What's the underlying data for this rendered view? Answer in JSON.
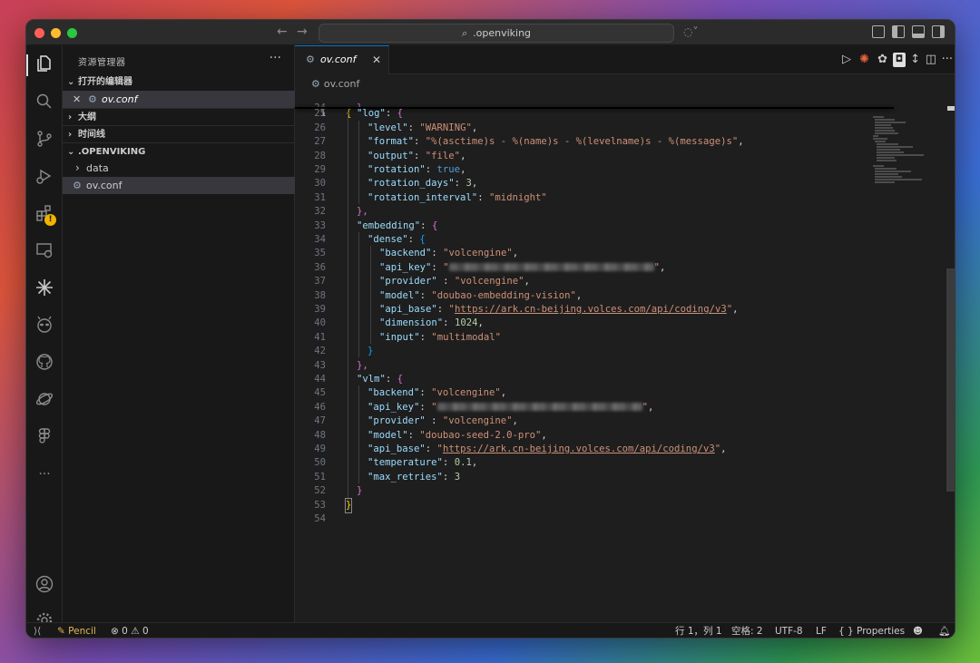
{
  "titlebar": {
    "search_text": ".openviking",
    "back_arrow": "←",
    "forward_arrow": "→"
  },
  "activity_icons": [
    "explorer-icon",
    "search-icon",
    "source-control-icon",
    "run-debug-icon",
    "extensions-icon",
    "remote-explorer-icon",
    "sparkle-icon",
    "alien-icon",
    "github-icon",
    "planet-icon",
    "figma-icon",
    "more-icon",
    "account-icon",
    "settings-icon"
  ],
  "sidebar": {
    "title": "资源管理器",
    "more": "···",
    "open_editors": "打开的编辑器",
    "open_editor_file": "ov.conf",
    "outline": "大纲",
    "timeline": "时间线",
    "workspace": ".OPENVIKING",
    "tree": [
      {
        "label": "data"
      },
      {
        "label": "ov.conf"
      }
    ]
  },
  "tab": {
    "label": "ov.conf",
    "close": "✕"
  },
  "breadcrumb": {
    "file": "ov.conf"
  },
  "editor": {
    "sticky_line": {
      "number": "1",
      "text": "{"
    },
    "lines": [
      {
        "n": "25"
      },
      {
        "n": "26"
      },
      {
        "n": "27"
      },
      {
        "n": "28"
      },
      {
        "n": "29"
      },
      {
        "n": "30"
      },
      {
        "n": "31"
      },
      {
        "n": "32"
      },
      {
        "n": "33"
      },
      {
        "n": "34"
      },
      {
        "n": "35"
      },
      {
        "n": "36"
      },
      {
        "n": "37"
      },
      {
        "n": "38"
      },
      {
        "n": "39"
      },
      {
        "n": "40"
      },
      {
        "n": "41"
      },
      {
        "n": "42"
      },
      {
        "n": "43"
      },
      {
        "n": "44"
      },
      {
        "n": "45"
      },
      {
        "n": "46"
      },
      {
        "n": "47"
      },
      {
        "n": "48"
      },
      {
        "n": "49"
      },
      {
        "n": "50"
      },
      {
        "n": "51"
      },
      {
        "n": "52"
      },
      {
        "n": "53"
      },
      {
        "n": "54"
      }
    ],
    "code": {
      "log_key": "\"log\"",
      "level_key": "\"level\"",
      "level_val": "\"WARNING\"",
      "format_key": "\"format\"",
      "format_val": "\"%(asctime)s - %(name)s - %(levelname)s - %(message)s\"",
      "output_key": "\"output\"",
      "output_val": "\"file\"",
      "rotation_key": "\"rotation\"",
      "rotation_val": "true",
      "rotation_days_key": "\"rotation_days\"",
      "rotation_days_val": "3",
      "rotation_interval_key": "\"rotation_interval\"",
      "rotation_interval_val": "\"midnight\"",
      "embedding_key": "\"embedding\"",
      "dense_key": "\"dense\"",
      "backend_key": "\"backend\"",
      "backend_val": "\"volcengine\"",
      "api_key_key": "\"api_key\"",
      "provider_key": "\"provider\"",
      "provider_val": "\"volcengine\"",
      "model_key": "\"model\"",
      "emb_model_val": "\"doubao-embedding-vision\"",
      "api_base_key": "\"api_base\"",
      "api_base_url": "https://ark.cn-beijing.volces.com/api/coding/v3",
      "dimension_key": "\"dimension\"",
      "dimension_val": "1024",
      "input_key": "\"input\"",
      "input_val": "\"multimodal\"",
      "vlm_key": "\"vlm\"",
      "vlm_model_val": "\"doubao-seed-2.0-pro\"",
      "temperature_key": "\"temperature\"",
      "temperature_val": "0.1",
      "max_retries_key": "\"max_retries\"",
      "max_retries_val": "3"
    }
  },
  "statusbar": {
    "pencil": "Pencil",
    "errors": "0",
    "warnings": "0",
    "position": "行 1，列 1",
    "spaces": "空格: 2",
    "encoding": "UTF-8",
    "eol": "LF",
    "language": "Properties"
  },
  "colors": {
    "accent": "#0078d4",
    "warning_badge": "#f0b400"
  }
}
